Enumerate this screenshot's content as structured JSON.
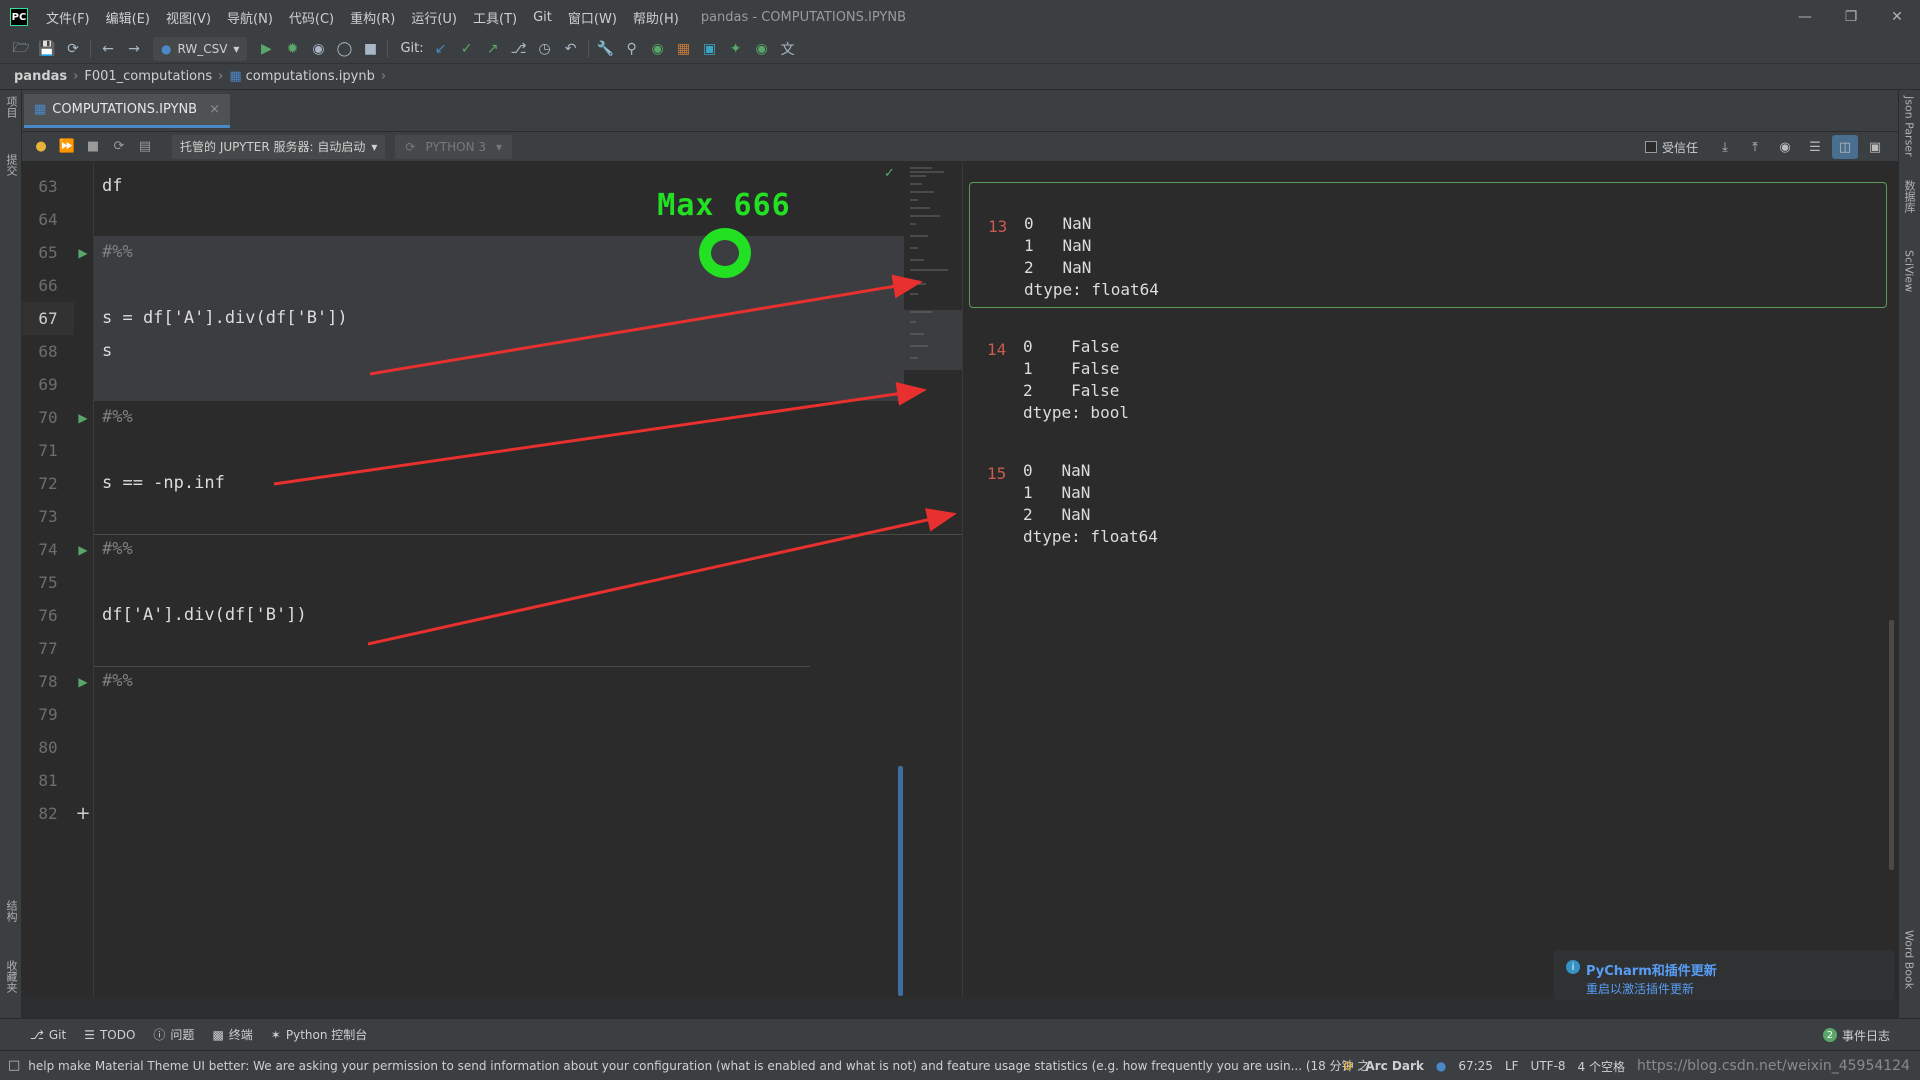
{
  "app": {
    "logo": "PC",
    "window_title": "pandas - COMPUTATIONS.IPYNB"
  },
  "menu": [
    "文件(F)",
    "编辑(E)",
    "视图(V)",
    "导航(N)",
    "代码(C)",
    "重构(R)",
    "运行(U)",
    "工具(T)",
    "Git",
    "窗口(W)",
    "帮助(H)"
  ],
  "toolbar": {
    "run_config": "RW_CSV",
    "git_label": "Git:"
  },
  "breadcrumb": [
    "pandas",
    "F001_computations",
    "computations.ipynb"
  ],
  "left_strip": {
    "project": "项目",
    "commit": "提交",
    "structure": "结构",
    "favorites": "收藏夹"
  },
  "right_strip": {
    "json_parser": "Json Parser",
    "database": "数据库",
    "sciview": "SciView",
    "word_book": "Word Book"
  },
  "tab": {
    "label": "COMPUTATIONS.IPYNB"
  },
  "nb_toolbar": {
    "jupyter_server": "托管的 JUPYTER 服务器: 自动启动",
    "kernel": "PYTHON 3",
    "trusted": "受信任"
  },
  "editor": {
    "lines": [
      {
        "n": "63",
        "code": "df"
      },
      {
        "n": "64",
        "code": ""
      },
      {
        "n": "65",
        "code": "#%%"
      },
      {
        "n": "66",
        "code": ""
      },
      {
        "n": "67",
        "code": "s = df['A'].div(df['B'])"
      },
      {
        "n": "68",
        "code": "s"
      },
      {
        "n": "69",
        "code": ""
      },
      {
        "n": "70",
        "code": "#%%"
      },
      {
        "n": "71",
        "code": ""
      },
      {
        "n": "72",
        "code": "s == -np.inf"
      },
      {
        "n": "73",
        "code": ""
      },
      {
        "n": "74",
        "code": "#%%"
      },
      {
        "n": "75",
        "code": ""
      },
      {
        "n": "76",
        "code": "df['A'].div(df['B'])"
      },
      {
        "n": "77",
        "code": ""
      },
      {
        "n": "78",
        "code": "#%%"
      },
      {
        "n": "79",
        "code": ""
      },
      {
        "n": "80",
        "code": ""
      },
      {
        "n": "81",
        "code": ""
      },
      {
        "n": "82",
        "code": ""
      }
    ],
    "add_cell": "+"
  },
  "game_overlay": {
    "text": "Max 666",
    "color": "#22e022"
  },
  "outputs": [
    {
      "num": "13",
      "lines": [
        "0   NaN",
        "1   NaN",
        "2   NaN",
        "dtype: float64"
      ]
    },
    {
      "num": "14",
      "lines": [
        "0    False",
        "1    False",
        "2    False",
        "dtype: bool"
      ]
    },
    {
      "num": "15",
      "lines": [
        "0   NaN",
        "1   NaN",
        "2   NaN",
        "dtype: float64"
      ]
    }
  ],
  "notification": {
    "title": "PyCharm和插件更新",
    "link": "重启以激活插件更新"
  },
  "bottom_tools": {
    "git": "Git",
    "todo": "TODO",
    "problems": "问题",
    "terminal": "终端",
    "python_console": "Python 控制台",
    "event_log": "事件日志",
    "event_count": "2"
  },
  "status": {
    "message": "help make Material Theme UI better: We are asking your permission to send information about your configuration (what is enabled and what is not) and feature usage statistics (e.g. how frequently you are usin... (18 分钟 之前)",
    "theme": "Arc Dark",
    "position": "67:25",
    "line_sep": "LF",
    "encoding": "UTF-8",
    "indent": "4 个空格",
    "watermark": "https://blog.csdn.net/weixin_45954124"
  },
  "colors": {
    "accent": "#4a88c7",
    "run_green": "#59a869",
    "arrow_red": "#e8302e",
    "output_num": "#cc5a4e",
    "link": "#589df6"
  }
}
